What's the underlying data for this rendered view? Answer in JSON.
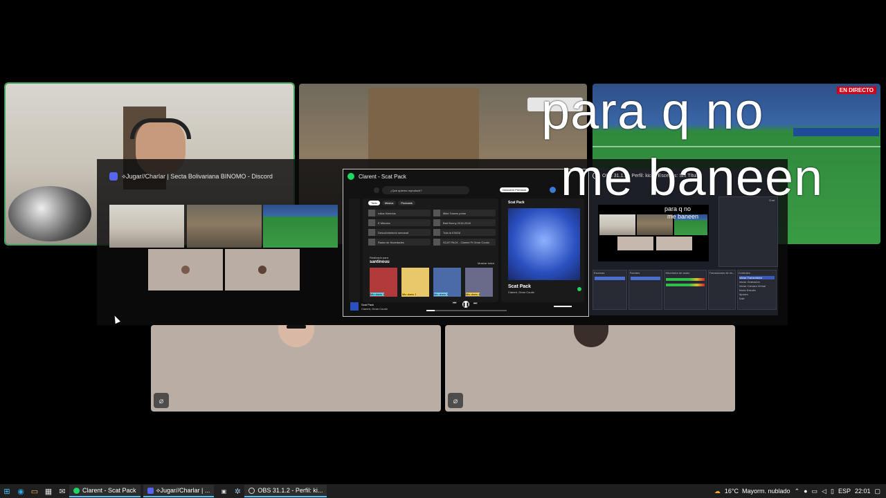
{
  "overlay_caption": {
    "line1": "para q no",
    "line2": "me baneen"
  },
  "stream_badge": "EN DIRECTO",
  "discord_window": {
    "title": "⟡Jugar//Charlar | Secta Bolivariana BINOMO - Discord"
  },
  "spotify_window": {
    "title": "Clarent - Scat Pack",
    "search_placeholder": "¿Qué quieres reproducir?",
    "premium_button": "Descubrir Premium",
    "filter_chips": [
      "Todo",
      "Música",
      "Podcasts"
    ],
    "shortcuts": [
      "rollos 9/mintos",
      "Mike Towers prime",
      "E Minutos",
      "Bad Bunny 2016-2018",
      "Descubrimiento semanal",
      "Tula la K!NGA",
      "Radar de Novedades",
      "SCAT PACK - Clarent Ft Omar Courtz"
    ],
    "section_label": "Realizado para",
    "section_title": "santinouu",
    "show_all": "Mostrar todos",
    "mixes": [
      "Mix diario 1",
      "Mix diario 2",
      "Mix diario 3",
      "Mix diario 4"
    ],
    "now_playing_panel_label": "Scat Pack",
    "track_title": "Scat Pack",
    "track_artist": "Clarent, Omar Courtz",
    "player_track": "Scat Pack",
    "player_artist": "Clarent, Omar Courtz"
  },
  "obs_window": {
    "title": "OBS 31.1.2 - Perfil: kick - Escenas: Sin Título",
    "mini_caption_1": "para q no",
    "mini_caption_2": "me baneen",
    "panels": [
      "Escenas",
      "Fuentes",
      "Mezclador de audio",
      "Transiciones de es...",
      "Controles"
    ],
    "controls": [
      "Iniciar Transmisión",
      "Iniciar Grabación",
      "Iniciar Cámara Virtual",
      "Modo Estudio",
      "Ajustes",
      "Salir"
    ],
    "chat_label": "Chat"
  },
  "taskbar": {
    "apps": [
      "Clarent - Scat Pack",
      "⟡Jugar//Charlar | ...",
      "OBS 31.1.2 - Perfil: ki..."
    ],
    "weather": "16°C  Mayorm. nublado",
    "language": "ESP",
    "time": "22:01"
  },
  "colors": {
    "discord_blurple": "#5865f2",
    "spotify_green": "#1ed760",
    "speaking_green": "#3ba55d",
    "live_red": "#d0021b",
    "taskbar_accent": "#4cc2ff"
  }
}
